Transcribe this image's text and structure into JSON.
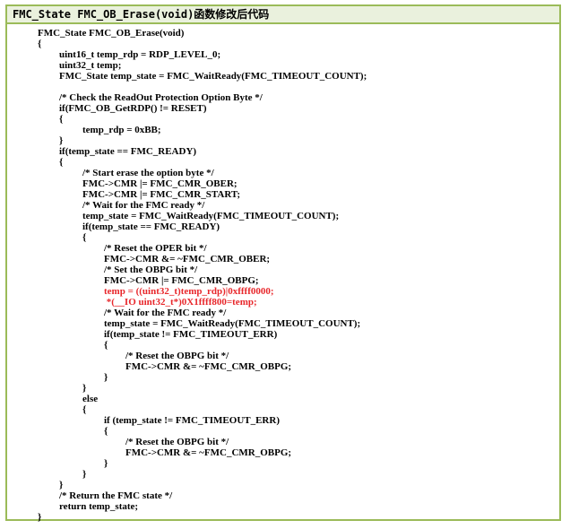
{
  "header": {
    "title": "FMC_State FMC_OB_Erase(void)函数修改后代码"
  },
  "code": {
    "lines": [
      {
        "text": "FMC_State FMC_OB_Erase(void)",
        "indent": 0,
        "red": false
      },
      {
        "text": "{",
        "indent": 0,
        "red": false
      },
      {
        "text": "uint16_t temp_rdp = RDP_LEVEL_0;",
        "indent": 1,
        "red": false
      },
      {
        "text": "uint32_t temp;",
        "indent": 1,
        "red": false
      },
      {
        "text": "FMC_State temp_state = FMC_WaitReady(FMC_TIMEOUT_COUNT);",
        "indent": 1,
        "red": false
      },
      {
        "text": "",
        "indent": 0,
        "red": false
      },
      {
        "text": "/* Check the ReadOut Protection Option Byte */",
        "indent": 1,
        "red": false
      },
      {
        "text": "if(FMC_OB_GetRDP() != RESET)",
        "indent": 1,
        "red": false
      },
      {
        "text": "{",
        "indent": 1,
        "red": false
      },
      {
        "text": "temp_rdp = 0xBB;",
        "indent": 2,
        "red": false
      },
      {
        "text": "}",
        "indent": 1,
        "red": false
      },
      {
        "text": "if(temp_state == FMC_READY)",
        "indent": 1,
        "red": false
      },
      {
        "text": "{",
        "indent": 1,
        "red": false
      },
      {
        "text": "/* Start erase the option byte */",
        "indent": 2,
        "red": false
      },
      {
        "text": "FMC->CMR |= FMC_CMR_OBER;",
        "indent": 2,
        "red": false
      },
      {
        "text": "FMC->CMR |= FMC_CMR_START;",
        "indent": 2,
        "red": false
      },
      {
        "text": "/* Wait for the FMC ready */",
        "indent": 2,
        "red": false
      },
      {
        "text": "temp_state = FMC_WaitReady(FMC_TIMEOUT_COUNT);",
        "indent": 2,
        "red": false
      },
      {
        "text": "if(temp_state == FMC_READY)",
        "indent": 2,
        "red": false
      },
      {
        "text": "{",
        "indent": 2,
        "red": false
      },
      {
        "text": "/* Reset the OPER bit */",
        "indent": 3,
        "red": false
      },
      {
        "text": "FMC->CMR &= ~FMC_CMR_OBER;",
        "indent": 3,
        "red": false
      },
      {
        "text": "/* Set the OBPG bit */",
        "indent": 3,
        "red": false
      },
      {
        "text": "FMC->CMR |= FMC_CMR_OBPG;",
        "indent": 3,
        "red": false
      },
      {
        "text": "temp = ((uint32_t)temp_rdp)|0xffff0000;",
        "indent": 3,
        "red": true
      },
      {
        "text": " *(__IO uint32_t*)0X1ffff800=temp;",
        "indent": 3,
        "red": true
      },
      {
        "text": "/* Wait for the FMC ready */",
        "indent": 3,
        "red": false
      },
      {
        "text": "temp_state = FMC_WaitReady(FMC_TIMEOUT_COUNT);",
        "indent": 3,
        "red": false
      },
      {
        "text": "if(temp_state != FMC_TIMEOUT_ERR)",
        "indent": 3,
        "red": false
      },
      {
        "text": "{",
        "indent": 3,
        "red": false
      },
      {
        "text": "/* Reset the OBPG bit */",
        "indent": 4,
        "red": false
      },
      {
        "text": "FMC->CMR &= ~FMC_CMR_OBPG;",
        "indent": 4,
        "red": false
      },
      {
        "text": "}",
        "indent": 3,
        "red": false
      },
      {
        "text": "}",
        "indent": 2,
        "red": false
      },
      {
        "text": "else",
        "indent": 2,
        "red": false
      },
      {
        "text": "{",
        "indent": 2,
        "red": false
      },
      {
        "text": "if (temp_state != FMC_TIMEOUT_ERR)",
        "indent": 3,
        "red": false
      },
      {
        "text": "{",
        "indent": 3,
        "red": false
      },
      {
        "text": "/* Reset the OBPG bit */",
        "indent": 4,
        "red": false
      },
      {
        "text": "FMC->CMR &= ~FMC_CMR_OBPG;",
        "indent": 4,
        "red": false
      },
      {
        "text": "}",
        "indent": 3,
        "red": false
      },
      {
        "text": "}",
        "indent": 2,
        "red": false
      },
      {
        "text": "}",
        "indent": 1,
        "red": false
      },
      {
        "text": "/* Return the FMC state */",
        "indent": 1,
        "red": false
      },
      {
        "text": "return temp_state;",
        "indent": 1,
        "red": false
      },
      {
        "text": "}",
        "indent": 0,
        "red": false
      }
    ]
  },
  "colors": {
    "border": "#9bbb59",
    "header_bg": "#eaf1dd",
    "highlight": "#e8272b"
  }
}
